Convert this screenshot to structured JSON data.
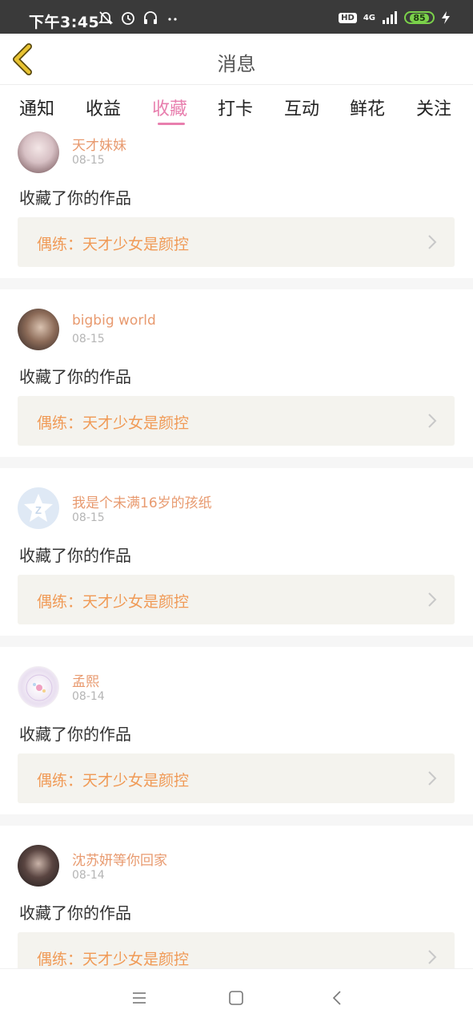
{
  "status_bar": {
    "time": "下午3:45",
    "hd": "HD",
    "network": "4G",
    "battery": "85",
    "icons": [
      "mute-icon",
      "alarm-icon",
      "headset-icon",
      "dots-icon",
      "signal-icon",
      "charging-icon"
    ]
  },
  "header": {
    "title": "消息",
    "back_icon": "chevron-left-icon"
  },
  "tabs": [
    {
      "label": "通知",
      "active": false
    },
    {
      "label": "收益",
      "active": false
    },
    {
      "label": "收藏",
      "active": true
    },
    {
      "label": "打卡",
      "active": false
    },
    {
      "label": "互动",
      "active": false
    },
    {
      "label": "鲜花",
      "active": false
    },
    {
      "label": "关注",
      "active": false
    }
  ],
  "colors": {
    "accent": "#e87fae",
    "username": "#e89a6f",
    "work_title": "#f09a56",
    "work_bg": "#f4f3ee",
    "back_arrow": "#e8c332"
  },
  "messages": [
    {
      "user": "天才妹妹",
      "date": "08-15",
      "action": "收藏了你的作品",
      "work": "偶练：天才少女是颜控"
    },
    {
      "user": "bigbig world",
      "date": "08-15",
      "action": "收藏了你的作品",
      "work": "偶练：天才少女是颜控"
    },
    {
      "user": "我是个未满16岁的孩纸",
      "date": "08-15",
      "action": "收藏了你的作品",
      "work": "偶练：天才少女是颜控"
    },
    {
      "user": "孟熙",
      "date": "08-14",
      "action": "收藏了你的作品",
      "work": "偶练：天才少女是颜控"
    },
    {
      "user": "沈苏妍等你回家",
      "date": "08-14",
      "action": "收藏了你的作品",
      "work": "偶练：天才少女是颜控"
    }
  ],
  "nav_bar": {
    "icons": [
      "menu-icon",
      "home-square-icon",
      "back-triangle-icon"
    ]
  }
}
